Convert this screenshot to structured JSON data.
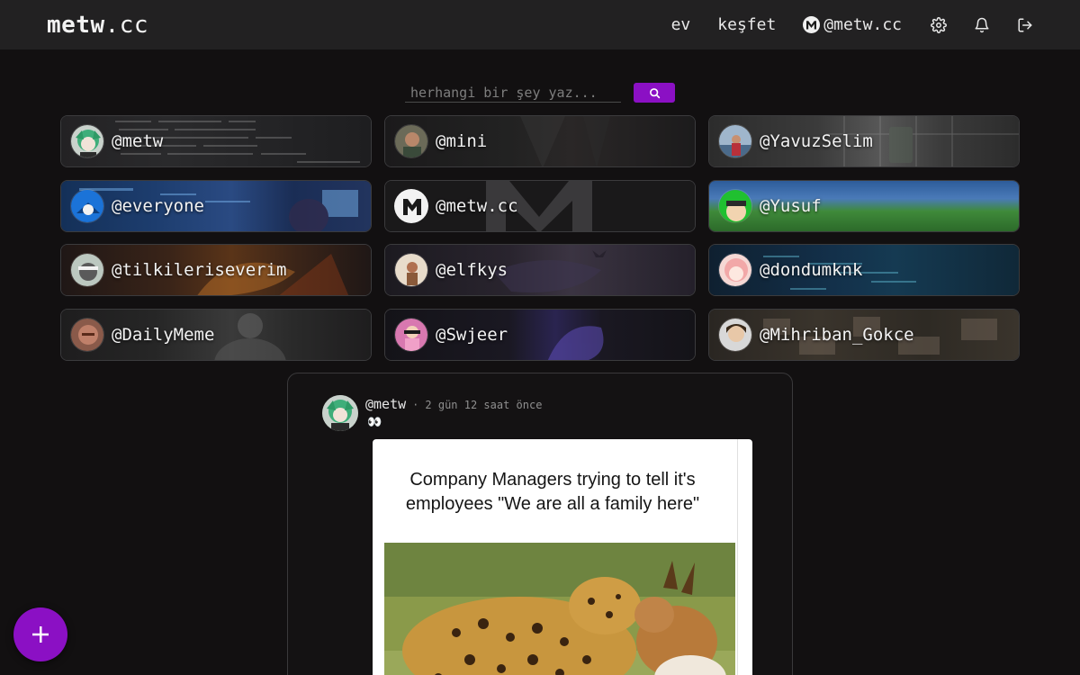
{
  "header": {
    "logo_bold": "metw",
    "logo_rest": ".cc",
    "nav": [
      {
        "label": "ev"
      },
      {
        "label": "keşfet"
      },
      {
        "label": "@metw.cc",
        "icon": "m-logo-icon"
      }
    ],
    "icons": [
      "gear-icon",
      "bell-icon",
      "logout-icon"
    ]
  },
  "search": {
    "placeholder": "herhangi bir şey yaz...",
    "button_icon": "search-icon"
  },
  "users": [
    {
      "handle": "@metw"
    },
    {
      "handle": "@mini"
    },
    {
      "handle": "@YavuzSelim"
    },
    {
      "handle": "@everyone"
    },
    {
      "handle": "@metw.cc"
    },
    {
      "handle": "@Yusuf"
    },
    {
      "handle": "@tilkileriseverim"
    },
    {
      "handle": "@elfkys"
    },
    {
      "handle": "@dondumknk"
    },
    {
      "handle": "@DailyMeme"
    },
    {
      "handle": "@Swjeer"
    },
    {
      "handle": "@Mihriban_Gokce"
    }
  ],
  "post": {
    "author": "@metw",
    "separator": "·",
    "time": "2 gün 12 saat önce",
    "content_emoji": "👀",
    "image": {
      "caption": "Company Managers trying to tell it's employees \"We are all a family here\""
    }
  },
  "fab": {
    "icon": "plus-icon"
  },
  "colors": {
    "accent": "#8b10c4",
    "header_bg": "#222122",
    "page_bg": "#121011"
  }
}
